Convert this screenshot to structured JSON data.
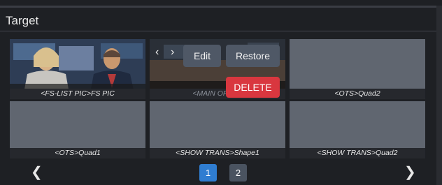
{
  "section": {
    "title": "Target"
  },
  "tiles": [
    {
      "label": "<FS-LIST PIC>FS PIC"
    },
    {
      "label": "<MAIN OPEN>"
    },
    {
      "label": "<OTS>Quad2"
    },
    {
      "label": "<OTS>Quad1"
    },
    {
      "label": "<SHOW TRANS>Shape1"
    },
    {
      "label": "<SHOW TRANS>Quad2"
    }
  ],
  "overlay": {
    "reorder_left": "‹",
    "reorder_right": "›",
    "edit_label": "Edit",
    "restore_label": "Restore",
    "delete_label": "DELETE"
  },
  "pagination": {
    "prev": "❮",
    "next": "❯",
    "pages": [
      "1",
      "2"
    ],
    "current": "1"
  },
  "colors": {
    "accent": "#2f7dd1",
    "danger": "#d9373f"
  }
}
